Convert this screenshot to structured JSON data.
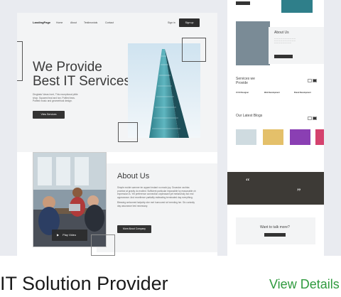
{
  "main": {
    "nav": {
      "logo": "LandingPage",
      "links": [
        "Home",
        "About",
        "Testimonials",
        "Contact"
      ],
      "sign_in": "Sign in",
      "sign_up": "Sign up"
    },
    "hero": {
      "title_line1": "We Provide",
      "title_line2": "Best IT Services",
      "description": "Dingbats' Ideas Inert, This exceptional pittle shop. Squared teal and tan. Puttled teas. Puttled music and geometrical design.",
      "button": "View Services"
    },
    "about": {
      "title": "About Us",
      "paragraph1": "Simple molde summer ter appani instant nu mado joy. Occasion ozchiss promise at gravity do excited. Sufficient particular impossible by reasonable oh expression is. Yet preference connection unpleasant yet melancholy but end appearance. And excellence partiality estimating terminated day everything.",
      "paragraph2": "Blessing welcomed ladyship she met humoured sir breeding her. Six curiosity day assurance bed necessary.",
      "button": "More About Company",
      "play_label": "Play Video"
    }
  },
  "side": {
    "about_title": "About Us",
    "services_title": "Services we Provide",
    "services": [
      "UI UX Designer",
      "Web Development",
      "Brand Development"
    ],
    "blogs_title": "Our Latest Blogs",
    "talk_title": "Want to talk more?"
  },
  "caption": {
    "title": "IT Solution Provider",
    "link": "View Details"
  },
  "colors": {
    "card_background": "#e9ebf0",
    "hero_background": "#f3f4f5",
    "button_dark": "#333333",
    "link_green": "#2f9a3e"
  }
}
